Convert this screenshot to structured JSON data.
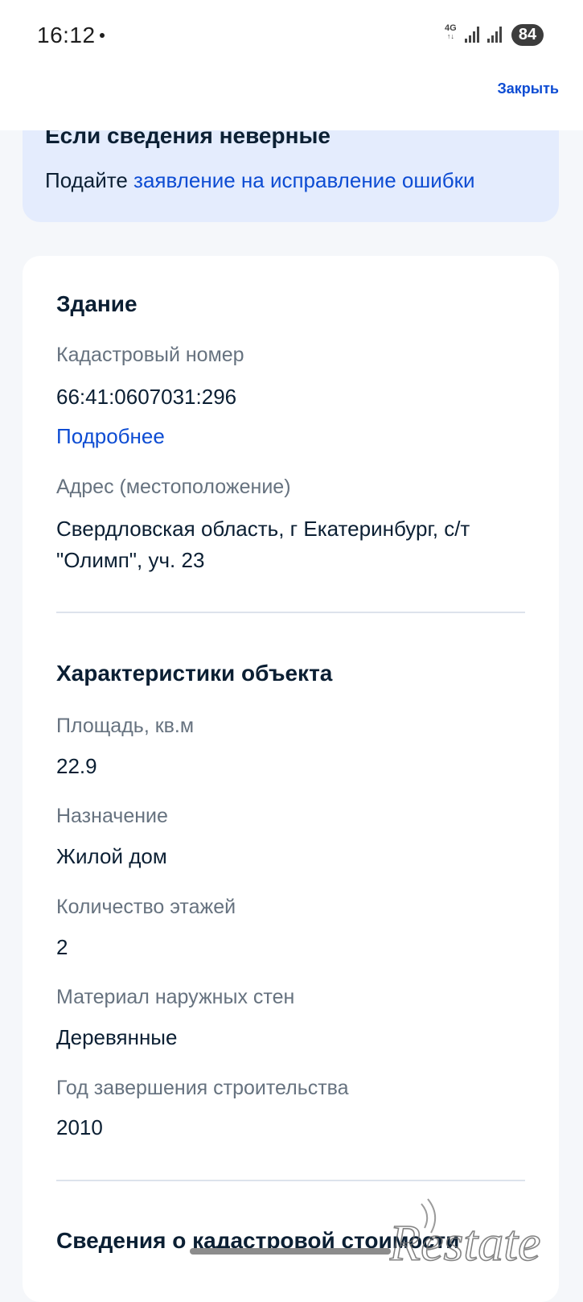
{
  "status_bar": {
    "time": "16:12",
    "network": "4G",
    "battery": "84"
  },
  "nav": {
    "close_label": "Закрыть"
  },
  "info_panel": {
    "title": "Если сведения неверные",
    "text_prefix": "Подайте ",
    "link_text": "заявление на исправление ошибки"
  },
  "building": {
    "title": "Здание",
    "cadastral_label": "Кадастровый номер",
    "cadastral_value": "66:41:0607031:296",
    "more_link": "Подробнее",
    "address_label": "Адрес (местоположение)",
    "address_line1": "Свердловская область, г Екатеринбург, с/т",
    "address_line2": "\"Олимп\", уч. 23"
  },
  "characteristics": {
    "title": "Характеристики объекта",
    "area_label": "Площадь, кв.м",
    "area_value": "22.9",
    "purpose_label": "Назначение",
    "purpose_value": "Жилой дом",
    "floors_label": "Количество этажей",
    "floors_value": "2",
    "walls_label": "Материал наружных стен",
    "walls_value": "Деревянные",
    "year_label": "Год завершения строительства",
    "year_value": "2010"
  },
  "next_section": {
    "title": "Сведения о кадастровой стоимости"
  },
  "watermark": {
    "text": "Restate"
  },
  "colors": {
    "link": "#0d4cd3",
    "info_panel_bg": "#e4ecfd",
    "page_bg": "#f5f7fa",
    "label_gray": "#66727f",
    "text_dark": "#0b1f33"
  }
}
